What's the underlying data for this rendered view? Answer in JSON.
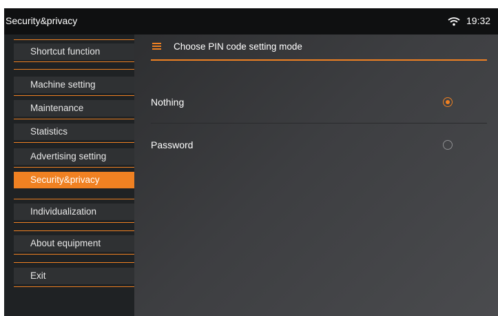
{
  "status_bar": {
    "title": "Security&privacy",
    "time": "19:32",
    "wifi_icon": "wifi-icon"
  },
  "sidebar": {
    "items": [
      {
        "label": "Shortcut function",
        "active": false
      },
      {
        "label": "Machine setting",
        "active": false
      },
      {
        "label": "Maintenance",
        "active": false
      },
      {
        "label": "Statistics",
        "active": false
      },
      {
        "label": "Advertising setting",
        "active": false
      },
      {
        "label": "Security&privacy",
        "active": true
      },
      {
        "label": "Individualization",
        "active": false
      },
      {
        "label": "About equipment",
        "active": false
      },
      {
        "label": "Exit",
        "active": false
      }
    ]
  },
  "content": {
    "header_icon": "menu-icon",
    "header_title": "Choose PIN code setting mode",
    "options": [
      {
        "label": "Nothing",
        "selected": true
      },
      {
        "label": "Password",
        "selected": false
      }
    ]
  },
  "colors": {
    "accent": "#f08122",
    "top_bar": "#0f1011",
    "sidebar_bg": "#1f2224",
    "sidebar_item_bg": "#2f3133",
    "content_bg": "#3a3b3d"
  }
}
